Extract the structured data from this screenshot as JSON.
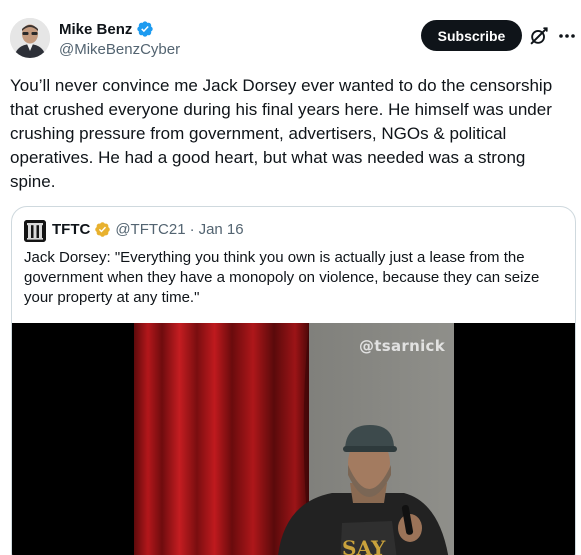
{
  "author": {
    "display_name": "Mike Benz",
    "handle": "@MikeBenzCyber",
    "verified_color": "#1d9bf0",
    "avatar_icon": "avatar-photo"
  },
  "actions": {
    "subscribe_label": "Subscribe",
    "grok_icon": "grok-icon",
    "more_icon": "more-icon"
  },
  "tweet": {
    "text": "You’ll never convince me Jack Dorsey ever wanted to do the censorship that crushed everyone during his final years here. He himself was under crushing pressure from government, advertisers, NGOs & political operatives. He had a good heart, but what was needed was a strong spine."
  },
  "quoted_tweet": {
    "display_name": "TFTC",
    "handle": "@TFTC21",
    "separator": "·",
    "date": "Jan 16",
    "verified_color": "#e8b12e",
    "text": "Jack Dorsey: \"Everything you think you own is actually just a lease from the government when they have a monopoly on violence, because they can seize your property at any time.\"",
    "video": {
      "watermark": "@tsarnick",
      "shirt_text": "SAY"
    }
  },
  "colors": {
    "text_primary": "#0f1419",
    "text_secondary": "#536471",
    "border": "#cfd9de",
    "button_bg": "#0f1419"
  }
}
